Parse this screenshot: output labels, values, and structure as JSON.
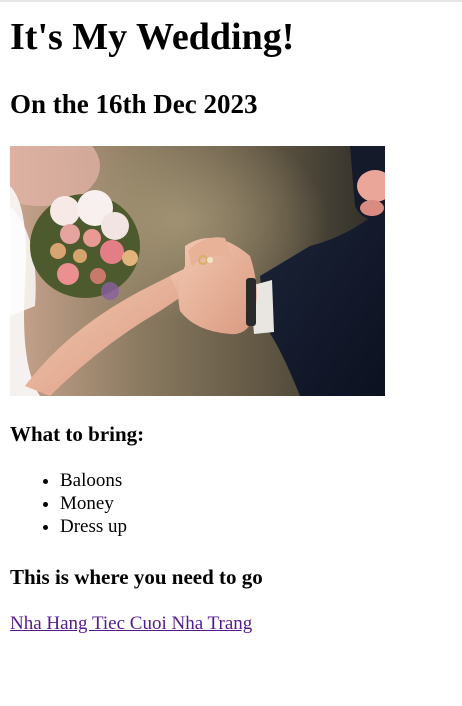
{
  "header": {
    "title": "It's My Wedding!",
    "date": "On the 16th Dec 2023"
  },
  "photo": {
    "subject": "wedding-rings-photo"
  },
  "bring": {
    "heading": "What to bring:",
    "items": [
      "Baloons",
      "Money",
      "Dress up"
    ]
  },
  "location": {
    "heading": "This is where you need to go",
    "link_text": "Nha Hang Tiec Cuoi Nha Trang"
  },
  "colors": {
    "link_visited": "#551a8b",
    "text": "#000000",
    "background": "#ffffff"
  }
}
